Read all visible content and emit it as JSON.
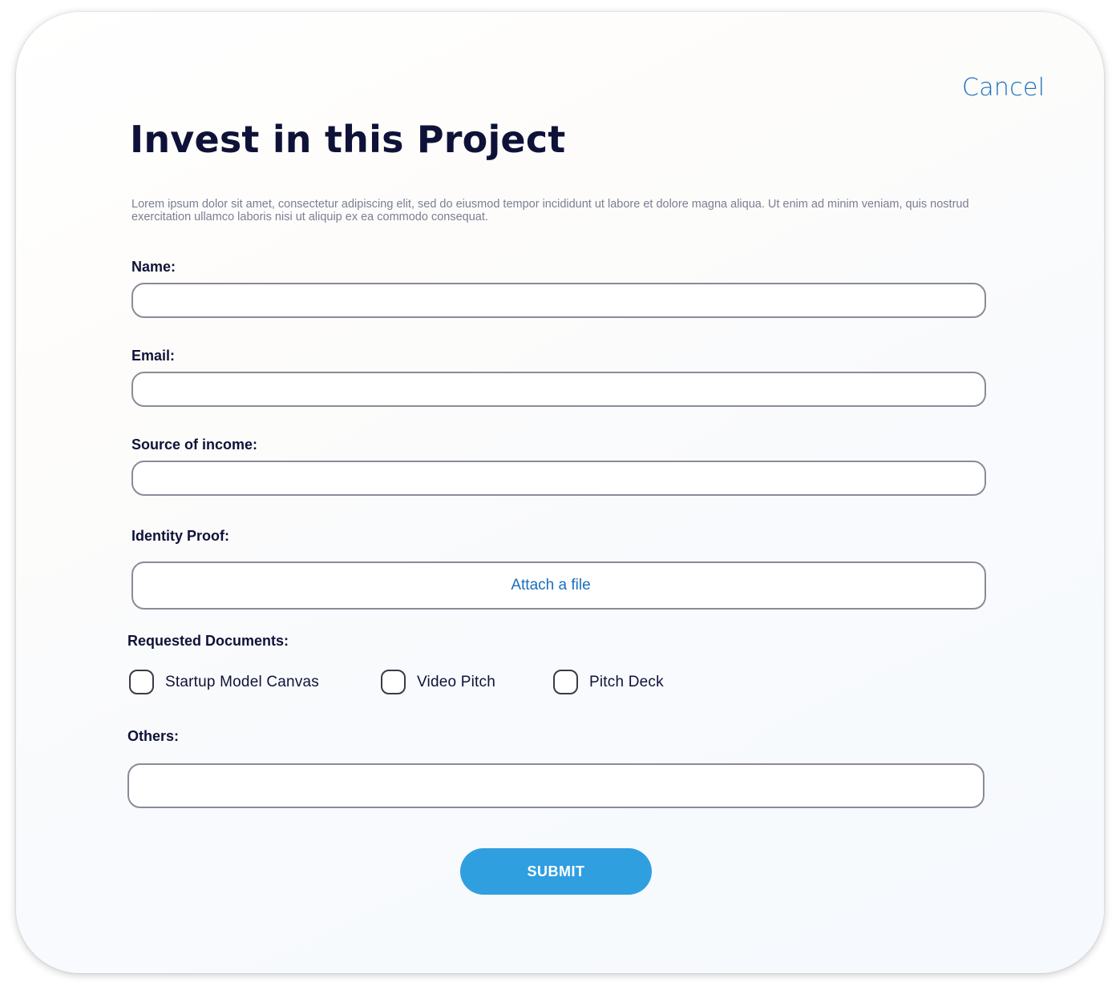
{
  "header": {
    "cancel_label": "Cancel",
    "title": "Invest in this Project",
    "description": "Lorem ipsum dolor sit amet, consectetur adipiscing elit, sed do eiusmod tempor incididunt ut labore et dolore magna aliqua. Ut enim ad minim veniam, quis nostrud exercitation ullamco laboris nisi ut aliquip ex ea commodo consequat."
  },
  "form": {
    "name": {
      "label": "Name:",
      "value": ""
    },
    "email": {
      "label": "Email:",
      "value": ""
    },
    "income": {
      "label": "Source of income:",
      "value": ""
    },
    "identity": {
      "label": "Identity Proof:",
      "attach_label": "Attach a file"
    },
    "documents": {
      "label": "Requested Documents:",
      "options": [
        {
          "label": "Startup Model Canvas",
          "checked": false
        },
        {
          "label": "Video Pitch",
          "checked": false
        },
        {
          "label": "Pitch Deck",
          "checked": false
        }
      ]
    },
    "others": {
      "label": "Others:",
      "value": ""
    },
    "submit_label": "SUBMIT"
  },
  "colors": {
    "accent": "#2f9fe0",
    "link": "#1a6fbd",
    "heading": "#0f1238",
    "border": "#8b8a98"
  }
}
